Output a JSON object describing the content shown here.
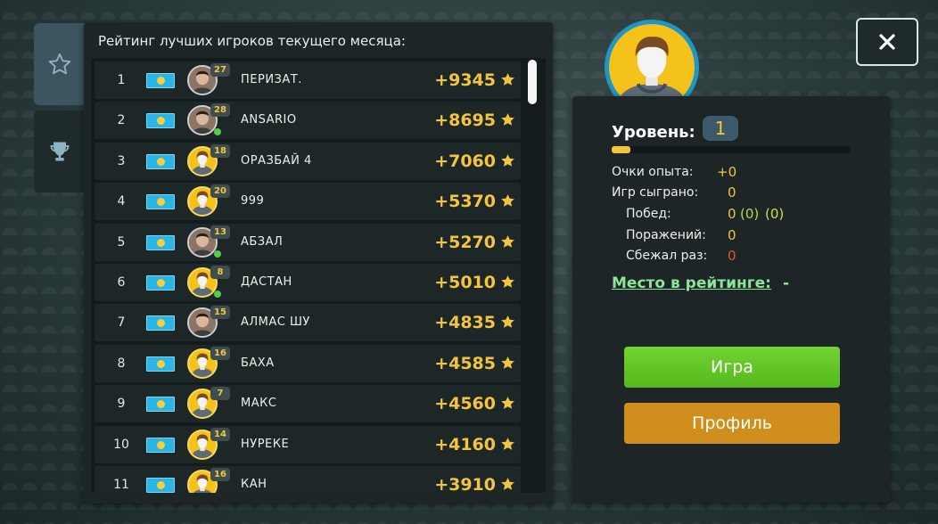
{
  "leaderboard": {
    "title": "Рейтинг лучших игроков текущего месяца:",
    "players": [
      {
        "rank": "1",
        "name": "ПЕРИЗАТ.",
        "level": "27",
        "score": "+9345",
        "photo": true,
        "online": false
      },
      {
        "rank": "2",
        "name": "ANSARIO",
        "level": "28",
        "score": "+8695",
        "photo": true,
        "online": true
      },
      {
        "rank": "3",
        "name": "ОРАЗБАЙ 4",
        "level": "18",
        "score": "+7060",
        "photo": false,
        "online": false
      },
      {
        "rank": "4",
        "name": "999",
        "level": "20",
        "score": "+5370",
        "photo": false,
        "online": false
      },
      {
        "rank": "5",
        "name": "АБЗАЛ",
        "level": "13",
        "score": "+5270",
        "photo": true,
        "online": true
      },
      {
        "rank": "6",
        "name": "ДАСТАН",
        "level": "8",
        "score": "+5010",
        "photo": false,
        "online": true
      },
      {
        "rank": "7",
        "name": "АЛМАС ШУ",
        "level": "15",
        "score": "+4835",
        "photo": true,
        "online": false
      },
      {
        "rank": "8",
        "name": "БАХА",
        "level": "16",
        "score": "+4585",
        "photo": false,
        "online": false
      },
      {
        "rank": "9",
        "name": "МАКС",
        "level": "7",
        "score": "+4560",
        "photo": false,
        "online": false
      },
      {
        "rank": "10",
        "name": "НУРЕКЕ",
        "level": "14",
        "score": "+4160",
        "photo": false,
        "online": false
      },
      {
        "rank": "11",
        "name": "КАН",
        "level": "16",
        "score": "+3910",
        "photo": false,
        "online": false
      }
    ]
  },
  "tabs": {
    "rating_icon": "star-icon",
    "tournament_icon": "trophy-icon"
  },
  "close": {
    "icon": "close-icon"
  },
  "stats": {
    "level_label": "Уровень:",
    "level_value": "1",
    "xp_fraction": 0.08,
    "rows": [
      {
        "label": "Очки опыта:",
        "value": "+0",
        "color": "#f3c43c"
      },
      {
        "label": "Игр сыграно:",
        "value": "0",
        "color": "#f3c43c"
      },
      {
        "label": "Побед:",
        "value": "0",
        "extra1": "(0)",
        "extra2": "(0)",
        "color": "#f3c43c"
      },
      {
        "label": "Поражений:",
        "value": "0",
        "color": "#f3c43c"
      },
      {
        "label": "Сбежал раз:",
        "value": "0",
        "color": "#e8542c"
      }
    ],
    "rating_label": "Место в рейтинге:",
    "rating_value": "-"
  },
  "buttons": {
    "play": "Игра",
    "profile": "Профиль"
  },
  "colors": {
    "gold": "#f3c43c",
    "play_green": "#62c626",
    "profile_orange": "#d08f1c",
    "rating_green": "#8ee49a"
  }
}
